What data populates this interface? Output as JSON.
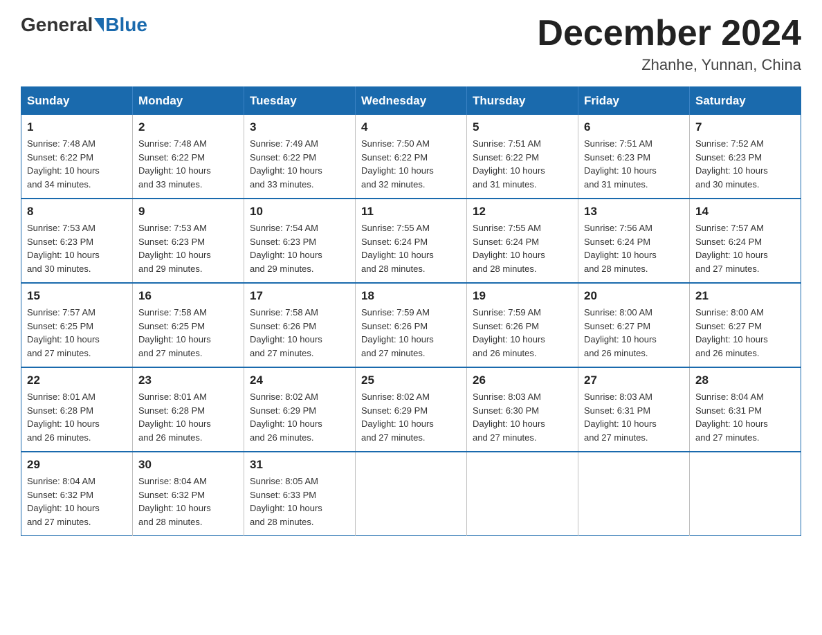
{
  "logo": {
    "general": "General",
    "blue": "Blue",
    "subtitle": ""
  },
  "header": {
    "title": "December 2024",
    "location": "Zhanhe, Yunnan, China"
  },
  "days_of_week": [
    "Sunday",
    "Monday",
    "Tuesday",
    "Wednesday",
    "Thursday",
    "Friday",
    "Saturday"
  ],
  "weeks": [
    [
      {
        "num": "1",
        "info": "Sunrise: 7:48 AM\nSunset: 6:22 PM\nDaylight: 10 hours\nand 34 minutes."
      },
      {
        "num": "2",
        "info": "Sunrise: 7:48 AM\nSunset: 6:22 PM\nDaylight: 10 hours\nand 33 minutes."
      },
      {
        "num": "3",
        "info": "Sunrise: 7:49 AM\nSunset: 6:22 PM\nDaylight: 10 hours\nand 33 minutes."
      },
      {
        "num": "4",
        "info": "Sunrise: 7:50 AM\nSunset: 6:22 PM\nDaylight: 10 hours\nand 32 minutes."
      },
      {
        "num": "5",
        "info": "Sunrise: 7:51 AM\nSunset: 6:22 PM\nDaylight: 10 hours\nand 31 minutes."
      },
      {
        "num": "6",
        "info": "Sunrise: 7:51 AM\nSunset: 6:23 PM\nDaylight: 10 hours\nand 31 minutes."
      },
      {
        "num": "7",
        "info": "Sunrise: 7:52 AM\nSunset: 6:23 PM\nDaylight: 10 hours\nand 30 minutes."
      }
    ],
    [
      {
        "num": "8",
        "info": "Sunrise: 7:53 AM\nSunset: 6:23 PM\nDaylight: 10 hours\nand 30 minutes."
      },
      {
        "num": "9",
        "info": "Sunrise: 7:53 AM\nSunset: 6:23 PM\nDaylight: 10 hours\nand 29 minutes."
      },
      {
        "num": "10",
        "info": "Sunrise: 7:54 AM\nSunset: 6:23 PM\nDaylight: 10 hours\nand 29 minutes."
      },
      {
        "num": "11",
        "info": "Sunrise: 7:55 AM\nSunset: 6:24 PM\nDaylight: 10 hours\nand 28 minutes."
      },
      {
        "num": "12",
        "info": "Sunrise: 7:55 AM\nSunset: 6:24 PM\nDaylight: 10 hours\nand 28 minutes."
      },
      {
        "num": "13",
        "info": "Sunrise: 7:56 AM\nSunset: 6:24 PM\nDaylight: 10 hours\nand 28 minutes."
      },
      {
        "num": "14",
        "info": "Sunrise: 7:57 AM\nSunset: 6:24 PM\nDaylight: 10 hours\nand 27 minutes."
      }
    ],
    [
      {
        "num": "15",
        "info": "Sunrise: 7:57 AM\nSunset: 6:25 PM\nDaylight: 10 hours\nand 27 minutes."
      },
      {
        "num": "16",
        "info": "Sunrise: 7:58 AM\nSunset: 6:25 PM\nDaylight: 10 hours\nand 27 minutes."
      },
      {
        "num": "17",
        "info": "Sunrise: 7:58 AM\nSunset: 6:26 PM\nDaylight: 10 hours\nand 27 minutes."
      },
      {
        "num": "18",
        "info": "Sunrise: 7:59 AM\nSunset: 6:26 PM\nDaylight: 10 hours\nand 27 minutes."
      },
      {
        "num": "19",
        "info": "Sunrise: 7:59 AM\nSunset: 6:26 PM\nDaylight: 10 hours\nand 26 minutes."
      },
      {
        "num": "20",
        "info": "Sunrise: 8:00 AM\nSunset: 6:27 PM\nDaylight: 10 hours\nand 26 minutes."
      },
      {
        "num": "21",
        "info": "Sunrise: 8:00 AM\nSunset: 6:27 PM\nDaylight: 10 hours\nand 26 minutes."
      }
    ],
    [
      {
        "num": "22",
        "info": "Sunrise: 8:01 AM\nSunset: 6:28 PM\nDaylight: 10 hours\nand 26 minutes."
      },
      {
        "num": "23",
        "info": "Sunrise: 8:01 AM\nSunset: 6:28 PM\nDaylight: 10 hours\nand 26 minutes."
      },
      {
        "num": "24",
        "info": "Sunrise: 8:02 AM\nSunset: 6:29 PM\nDaylight: 10 hours\nand 26 minutes."
      },
      {
        "num": "25",
        "info": "Sunrise: 8:02 AM\nSunset: 6:29 PM\nDaylight: 10 hours\nand 27 minutes."
      },
      {
        "num": "26",
        "info": "Sunrise: 8:03 AM\nSunset: 6:30 PM\nDaylight: 10 hours\nand 27 minutes."
      },
      {
        "num": "27",
        "info": "Sunrise: 8:03 AM\nSunset: 6:31 PM\nDaylight: 10 hours\nand 27 minutes."
      },
      {
        "num": "28",
        "info": "Sunrise: 8:04 AM\nSunset: 6:31 PM\nDaylight: 10 hours\nand 27 minutes."
      }
    ],
    [
      {
        "num": "29",
        "info": "Sunrise: 8:04 AM\nSunset: 6:32 PM\nDaylight: 10 hours\nand 27 minutes."
      },
      {
        "num": "30",
        "info": "Sunrise: 8:04 AM\nSunset: 6:32 PM\nDaylight: 10 hours\nand 28 minutes."
      },
      {
        "num": "31",
        "info": "Sunrise: 8:05 AM\nSunset: 6:33 PM\nDaylight: 10 hours\nand 28 minutes."
      },
      null,
      null,
      null,
      null
    ]
  ]
}
